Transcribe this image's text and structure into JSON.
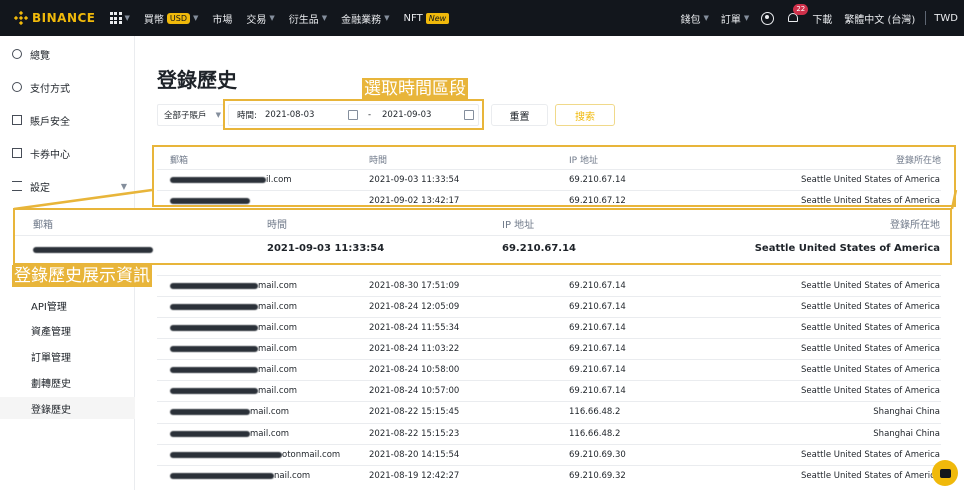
{
  "nav": {
    "brand": "BINANCE",
    "buy_crypto": "買幣",
    "currency_badge": "USD",
    "markets": "市場",
    "trade": "交易",
    "derivatives": "衍生品",
    "finance": "金融業務",
    "nft": "NFT",
    "new_badge": "New",
    "wallet": "錢包",
    "orders": "訂單",
    "notification_count": "22",
    "download": "下載",
    "language": "繁體中文 (台灣)",
    "fiat": "TWD"
  },
  "sidebar": {
    "items": [
      {
        "label": "總覽",
        "icon": "user-icon"
      },
      {
        "label": "支付方式",
        "icon": "dollar-icon"
      },
      {
        "label": "賬戶安全",
        "icon": "shield-icon"
      },
      {
        "label": "卡券中心",
        "icon": "ticket-icon"
      },
      {
        "label": "設定",
        "icon": "sliders-icon"
      }
    ],
    "subitems": [
      {
        "label": "API管理"
      },
      {
        "label": "資產管理"
      },
      {
        "label": "訂單管理"
      },
      {
        "label": "劃轉歷史"
      },
      {
        "label": "登錄歷史"
      }
    ]
  },
  "page": {
    "title": "登錄歷史",
    "account_select": "全部子賬戶",
    "time_label": "時間:",
    "date_from": "2021-08-03",
    "date_sep": "-",
    "date_to": "2021-09-03",
    "reset_label": "重置",
    "search_label": "搜索"
  },
  "annotations": {
    "time_range": "選取時間區段",
    "details": "登錄歷史展示資訊"
  },
  "table": {
    "columns": [
      "郵箱",
      "時間",
      "IP 地址",
      "登錄所在地"
    ],
    "rows": [
      {
        "email_suffix": "il.com",
        "time": "2021-09-03 11:33:54",
        "ip": "69.210.67.14",
        "location": "Seattle United States of America"
      },
      {
        "email_suffix": "",
        "time": "2021-09-02 13:42:17",
        "ip": "69.210.67.12",
        "location": "Seattle United States of America"
      },
      {
        "email_suffix": "mail.com",
        "time": "2021-08-30 17:51:09",
        "ip": "69.210.67.14",
        "location": "Seattle United States of America"
      },
      {
        "email_suffix": "mail.com",
        "time": "2021-08-24 12:05:09",
        "ip": "69.210.67.14",
        "location": "Seattle United States of America"
      },
      {
        "email_suffix": "mail.com",
        "time": "2021-08-24 11:55:34",
        "ip": "69.210.67.14",
        "location": "Seattle United States of America"
      },
      {
        "email_suffix": "mail.com",
        "time": "2021-08-24 11:03:22",
        "ip": "69.210.67.14",
        "location": "Seattle United States of America"
      },
      {
        "email_suffix": "mail.com",
        "time": "2021-08-24 10:58:00",
        "ip": "69.210.67.14",
        "location": "Seattle United States of America"
      },
      {
        "email_suffix": "mail.com",
        "time": "2021-08-24 10:57:00",
        "ip": "69.210.67.14",
        "location": "Seattle United States of America"
      },
      {
        "email_suffix": "mail.com",
        "time": "2021-08-22 15:15:45",
        "ip": "116.66.48.2",
        "location": "Shanghai China"
      },
      {
        "email_suffix": "mail.com",
        "time": "2021-08-22 15:15:23",
        "ip": "116.66.48.2",
        "location": "Shanghai China"
      },
      {
        "email_suffix": "otonmail.com",
        "time": "2021-08-20 14:15:54",
        "ip": "69.210.69.30",
        "location": "Seattle United States of America"
      },
      {
        "email_suffix": "nail.com",
        "time": "2021-08-19 12:42:27",
        "ip": "69.210.69.32",
        "location": "Seattle United States of America"
      }
    ],
    "zoom_row": {
      "time": "2021-09-03 11:33:54",
      "ip": "69.210.67.14",
      "location": "Seattle United States of America"
    }
  }
}
